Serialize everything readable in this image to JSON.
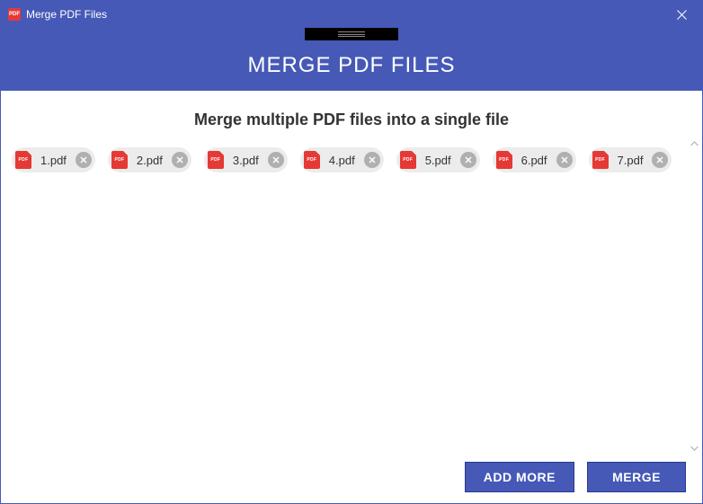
{
  "window": {
    "title": "Merge PDF Files"
  },
  "header": {
    "title": "MERGE PDF FILES"
  },
  "main": {
    "subtitle": "Merge multiple PDF files into a single file"
  },
  "files": [
    {
      "name": "1.pdf"
    },
    {
      "name": "2.pdf"
    },
    {
      "name": "3.pdf"
    },
    {
      "name": "4.pdf"
    },
    {
      "name": "5.pdf"
    },
    {
      "name": "6.pdf"
    },
    {
      "name": "7.pdf"
    }
  ],
  "buttons": {
    "add_more": "ADD MORE",
    "merge": "MERGE"
  },
  "icon_labels": {
    "pdf": "PDF"
  }
}
